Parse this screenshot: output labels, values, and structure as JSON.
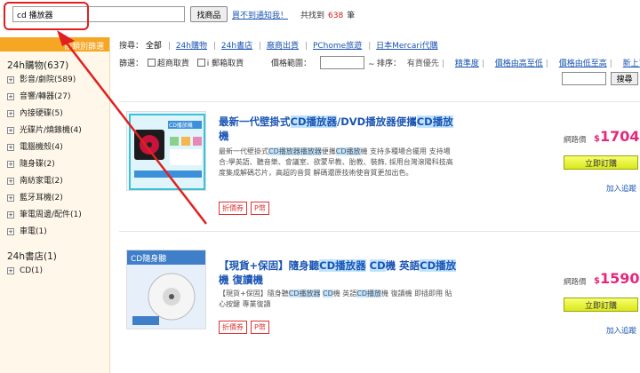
{
  "search": {
    "value": "cd 播放器",
    "button": "找商品",
    "notify": "買不到通知我！",
    "count_prefix": "共找到",
    "count": "638",
    "count_suffix": "筆"
  },
  "sidebar": {
    "header": "依類別篩選",
    "groups": [
      {
        "title": "24h購物(637)",
        "items": [
          "影音/劇院(589)",
          "音響/轉器(27)",
          "內接硬碟(5)",
          "光碟片/燒錄機(4)",
          "電腦機殼(4)",
          "隨身碟(2)",
          "南紡家電(2)",
          "藍牙耳機(2)",
          "筆電周邊/配件(1)",
          "車電(1)"
        ]
      },
      {
        "title": "24h書店(1)",
        "items": [
          "CD(1)"
        ]
      }
    ]
  },
  "filters": {
    "sources_label": "搜尋：",
    "sources": [
      "全部",
      "24h購物",
      "24h書店",
      "廠商出貨",
      "PChome旅遊",
      "日本Mercari代購"
    ],
    "options_label": "篩選：",
    "options": [
      "超商取貨",
      "i 郵箱取貨"
    ],
    "price_label": "價格範圍：",
    "price_tilde": "~",
    "sort_label": "排序：",
    "sort_current": "有貨優先",
    "sort_options": [
      "精準度",
      "價格由高至低",
      "價格由低至高",
      "新上市"
    ],
    "search_button": "搜尋"
  },
  "products": [
    {
      "title_parts": [
        "最新一代壁掛式",
        "CD播放器",
        "/DVD播放器便攜",
        "CD播放",
        "機"
      ],
      "desc_parts": [
        "最新一代壁掛式",
        "CD播放器播放器",
        "便攜",
        "CD播放",
        "機 支持多種場合擺用 支持場合:學英語、聽音樂、會議室、欲蒙早教、胎教、裝飾, 採用台灣滾陽科技高度集成解碼芯片，高超的音質 解碼還原技術使音質更加出色。"
      ],
      "thumb_text": "CD播放機",
      "tags": [
        "折價券",
        "P幣"
      ],
      "price_label": "網路價",
      "currency": "$",
      "price": "1704",
      "buy": "立即訂購",
      "track": "加入追蹤"
    },
    {
      "title_parts": [
        "【現貨+保固】隨身聽",
        "CD播放器",
        " ",
        "CD",
        "機 英語",
        "CD播放",
        "機 復讀機"
      ],
      "desc_parts": [
        "【現貨+保固】隨身聽",
        "CD播放器",
        " ",
        "CD",
        "機 英語",
        "CD播放",
        "機 復讀機 即插即用 貼心按鍵 專業復讀"
      ],
      "thumb_text": "CD隨身聽",
      "tags": [
        "折價券",
        "P幣"
      ],
      "price_label": "網路價",
      "currency": "$",
      "price": "1590",
      "buy": "立即訂購",
      "track": "加入追蹤"
    }
  ],
  "colors": {
    "accent": "#f5a623",
    "link": "#1a55b3",
    "price": "#e4287c",
    "annotation": "#e02020"
  }
}
